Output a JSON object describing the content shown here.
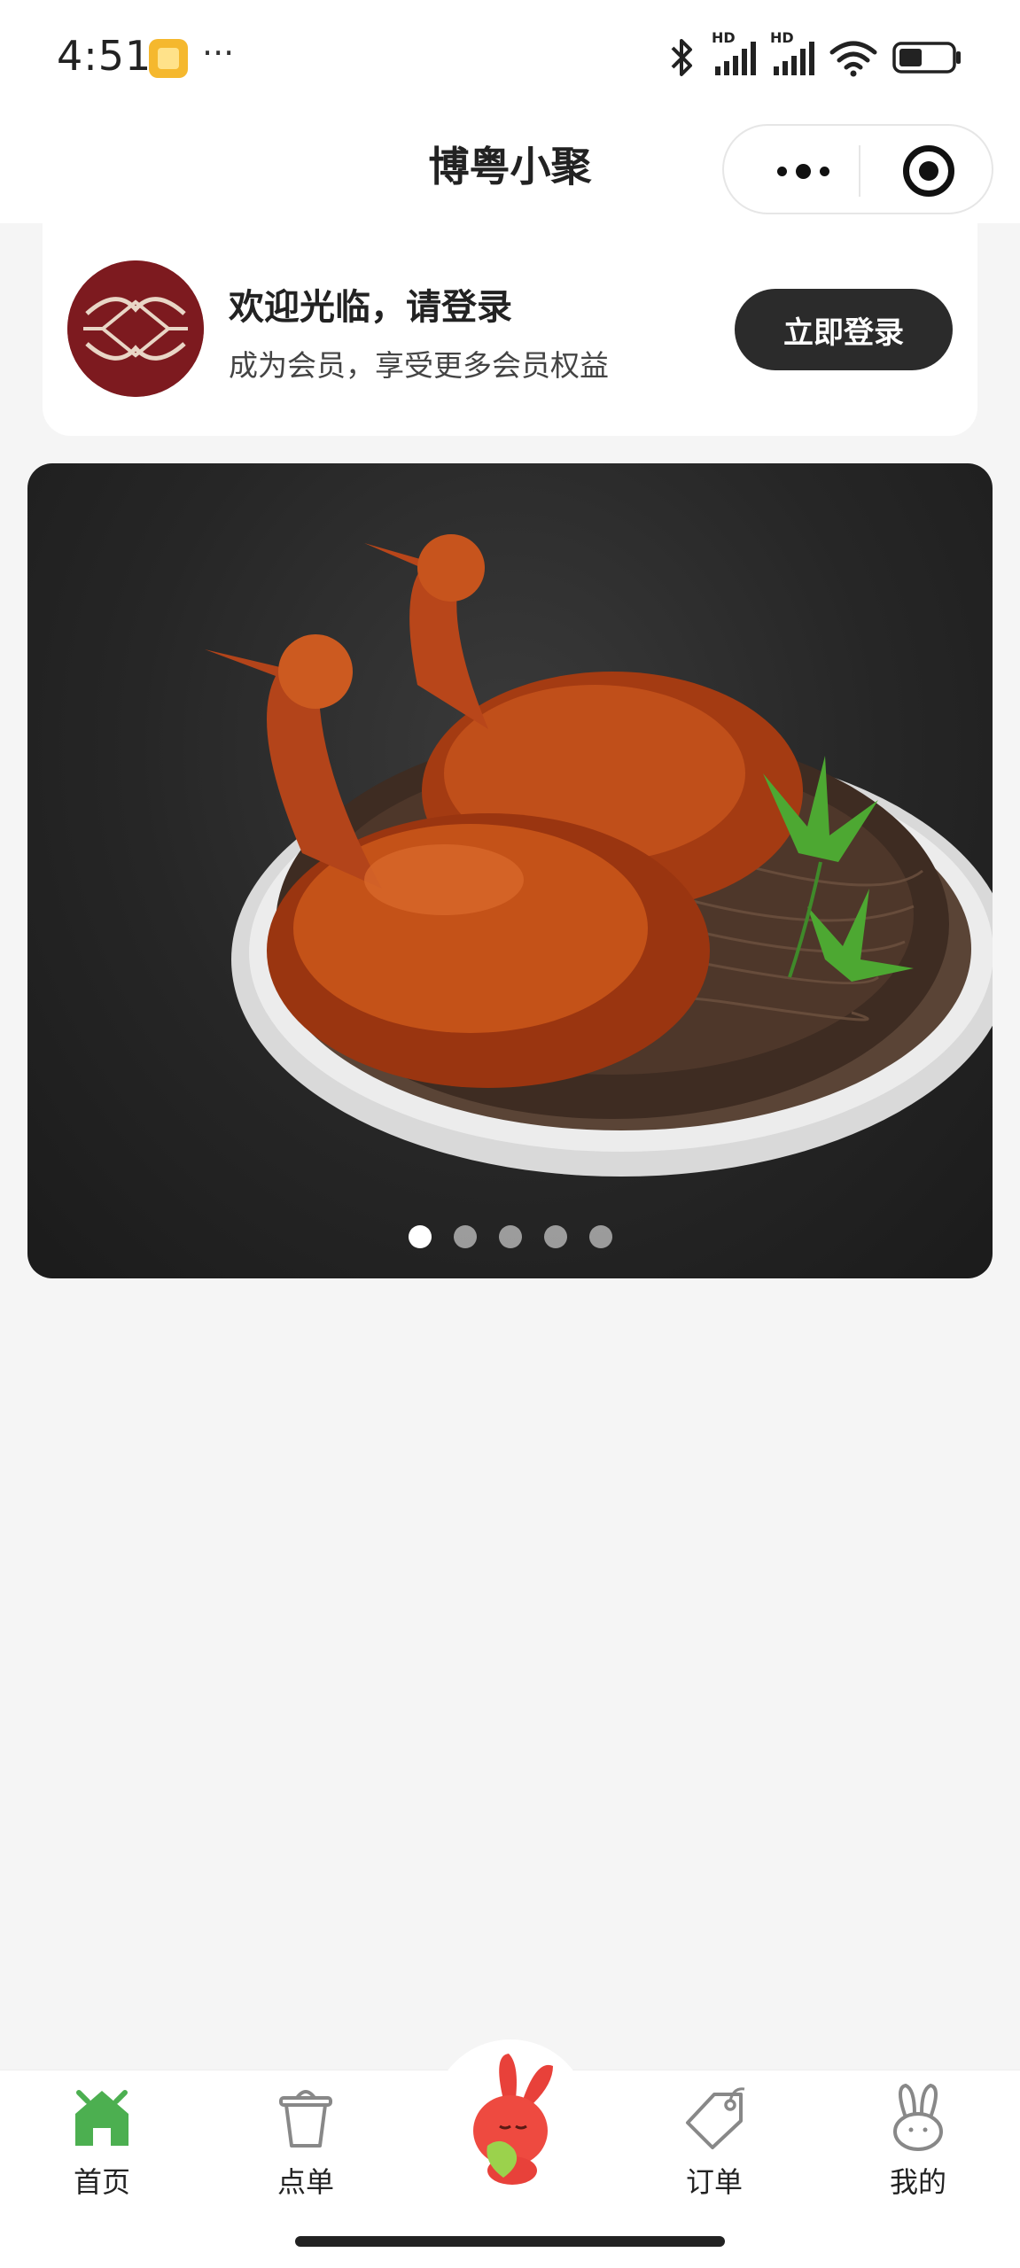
{
  "status_bar": {
    "time": "4:51",
    "more": "···",
    "signal_label": "HD",
    "battery_level": 0.45
  },
  "header": {
    "title": "博粤小聚",
    "capsule_more_icon": "more-dots-icon",
    "capsule_close_icon": "target-icon"
  },
  "member": {
    "welcome": "欢迎光临，请登录",
    "subtitle": "成为会员，享受更多会员权益",
    "login_label": "立即登录",
    "logo_color": "#7d1a1f"
  },
  "banner": {
    "slide_count": 5,
    "active_index": 0
  },
  "tabs": [
    {
      "label": "首页",
      "icon": "home-icon",
      "active": true
    },
    {
      "label": "点单",
      "icon": "cup-icon",
      "active": false
    },
    {
      "label": "",
      "icon": "rabbit-mascot-icon",
      "active": false
    },
    {
      "label": "订单",
      "icon": "tag-icon",
      "active": false
    },
    {
      "label": "我的",
      "icon": "rabbit-face-icon",
      "active": false
    }
  ],
  "colors": {
    "accent": "#2b2b2b",
    "home_green": "#4caf50",
    "background": "#f5f5f5"
  }
}
